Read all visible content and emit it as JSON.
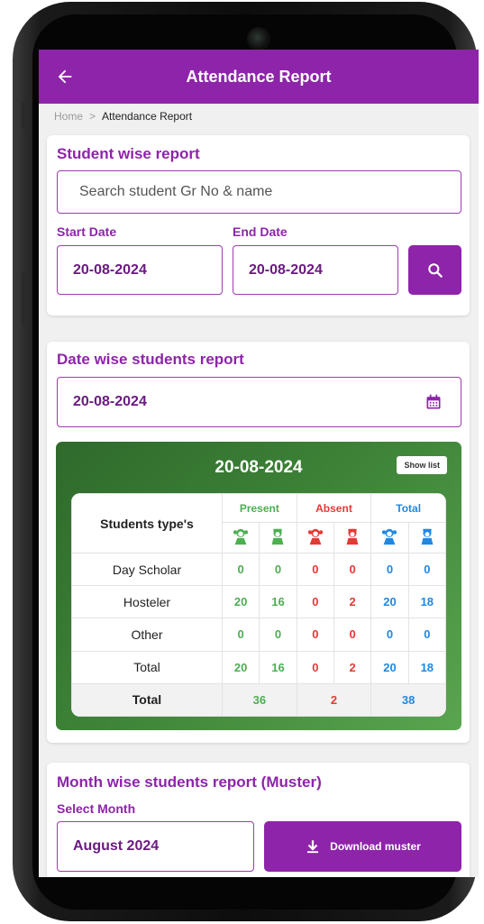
{
  "header": {
    "title": "Attendance Report",
    "back_icon": "arrow-left-icon"
  },
  "breadcrumb": {
    "home": "Home",
    "separator": ">",
    "current": "Attendance Report"
  },
  "student_wise": {
    "title": "Student wise report",
    "search_placeholder": "Search student Gr No & name",
    "start_label": "Start Date",
    "start_value": "20-08-2024",
    "end_label": "End Date",
    "end_value": "20-08-2024",
    "search_icon": "search-icon"
  },
  "date_wise": {
    "title": "Date wise students report",
    "date_value": "20-08-2024",
    "calendar_icon": "calendar-icon",
    "panel_date": "20-08-2024",
    "show_list_label": "Show list",
    "table": {
      "header_label": "Students type's",
      "groups": [
        "Present",
        "Absent",
        "Total"
      ],
      "icons": [
        "girl-icon",
        "boy-icon"
      ],
      "rows": [
        {
          "label": "Day Scholar",
          "values": [
            "0",
            "0",
            "0",
            "0",
            "0",
            "0"
          ]
        },
        {
          "label": "Hosteler",
          "values": [
            "20",
            "16",
            "0",
            "2",
            "20",
            "18"
          ]
        },
        {
          "label": "Other",
          "values": [
            "0",
            "0",
            "0",
            "0",
            "0",
            "0"
          ]
        },
        {
          "label": "Total",
          "values": [
            "20",
            "16",
            "0",
            "2",
            "20",
            "18"
          ]
        }
      ],
      "grand_total": {
        "label": "Total",
        "present": "36",
        "absent": "2",
        "total": "38"
      }
    }
  },
  "month_wise": {
    "title": "Month wise students report (Muster)",
    "select_label": "Select Month",
    "month_value": "August 2024",
    "download_label": "Download muster",
    "download_icon": "download-icon"
  },
  "colors": {
    "accent": "#8e24aa",
    "present": "#4caf50",
    "absent": "#e53935",
    "total": "#1e88e5",
    "panel": "#3d8237"
  }
}
